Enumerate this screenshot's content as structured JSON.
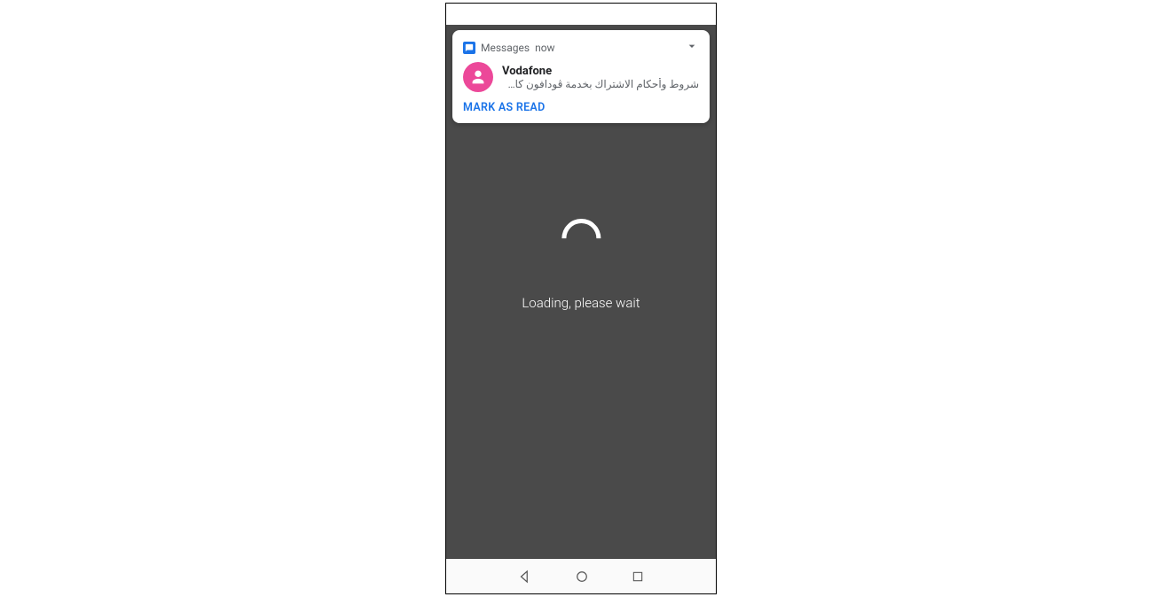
{
  "notification": {
    "app_name": "Messages",
    "time": "now",
    "sender": "Vodafone",
    "message": "شروط وأحكام الاشتراك بخدمة ڤودافون كاش ...",
    "action_label": "MARK AS READ"
  },
  "loading": {
    "text": "Loading, please wait"
  }
}
